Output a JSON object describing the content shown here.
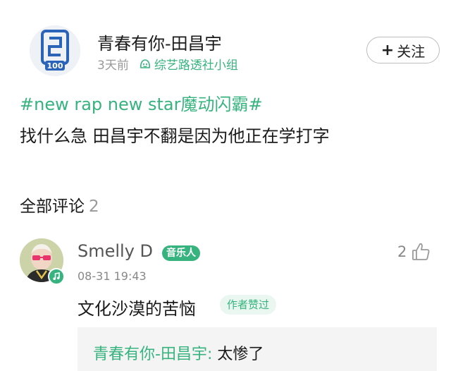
{
  "post": {
    "author": "青春有你-田昌宇",
    "time": "3天前",
    "group": "综艺路透社小组",
    "follow_label": "关注",
    "follow_plus": "+",
    "hashtag": "#new rap new star魔动闪霸#",
    "text": "找什么急 田昌宇不翻是因为他正在学打字"
  },
  "comments_section": {
    "title": "全部评论",
    "count": "2"
  },
  "comment": {
    "name": "Smelly D",
    "badge": "音乐人",
    "time": "08-31 19:43",
    "likes": "2",
    "text": "文化沙漠的苦恼",
    "author_liked": "作者赞过",
    "reply": {
      "author": "青春有你-田昌宇:",
      "text": "太惨了"
    }
  },
  "colors": {
    "accent": "#36b37e",
    "muted": "#999999",
    "reply_bg": "#f4f4f4"
  },
  "icons": {
    "group": "group-emoji-icon",
    "like": "thumbs-up-icon",
    "music": "music-note-icon"
  }
}
